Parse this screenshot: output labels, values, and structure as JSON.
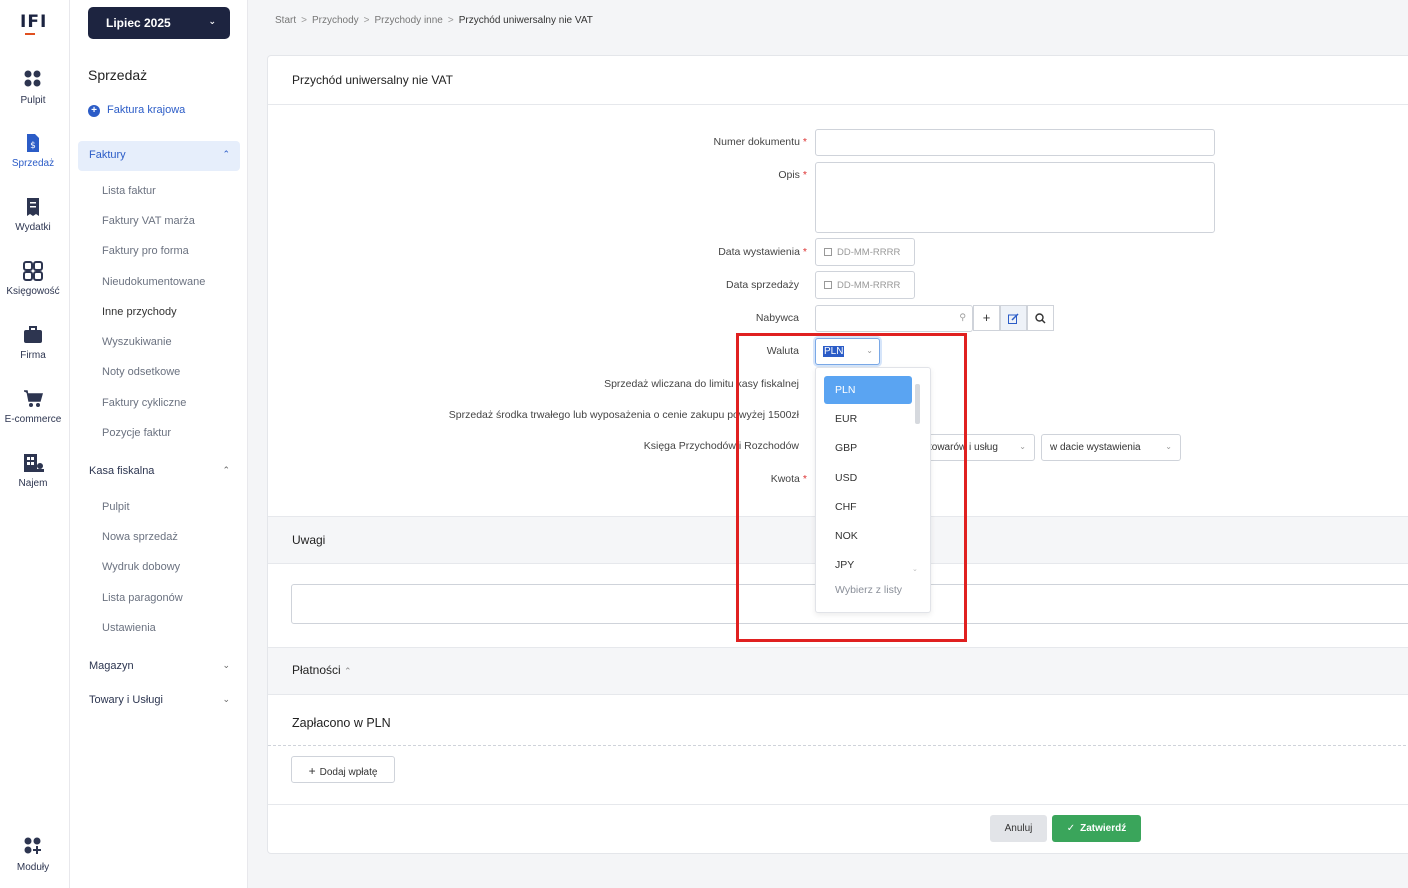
{
  "rail": {
    "logo": "IFI",
    "items": [
      {
        "label": "Pulpit",
        "icon": "dashboard-icon"
      },
      {
        "label": "Sprzedaż",
        "icon": "invoice-dollar-icon"
      },
      {
        "label": "Wydatki",
        "icon": "receipt-icon"
      },
      {
        "label": "Księgowość",
        "icon": "grid-icon"
      },
      {
        "label": "Firma",
        "icon": "briefcase-icon"
      },
      {
        "label": "E-commerce",
        "icon": "cart-icon"
      },
      {
        "label": "Najem",
        "icon": "building-icon"
      }
    ],
    "modules": "Moduły"
  },
  "sidebar": {
    "month": "Lipiec 2025",
    "title": "Sprzedaż",
    "quick_action": "Faktura krajowa",
    "groups": {
      "faktury": "Faktury",
      "kasa": "Kasa fiskalna",
      "magazyn": "Magazyn",
      "towary": "Towary i Usługi"
    },
    "faktury_items": [
      "Lista faktur",
      "Faktury VAT marża",
      "Faktury pro forma",
      "Nieudokumentowane",
      "Inne przychody",
      "Wyszukiwanie",
      "Noty odsetkowe",
      "Faktury cykliczne",
      "Pozycje faktur"
    ],
    "kasa_items": [
      "Pulpit",
      "Nowa sprzedaż",
      "Wydruk dobowy",
      "Lista paragonów",
      "Ustawienia"
    ]
  },
  "breadcrumb": [
    "Start",
    "Przychody",
    "Przychody inne",
    "Przychód uniwersalny nie VAT"
  ],
  "form": {
    "title": "Przychód uniwersalny nie VAT",
    "numer_label": "Numer dokumentu",
    "opis_label": "Opis",
    "data_wyst_label": "Data wystawienia",
    "data_sprz_label": "Data sprzedaży",
    "date_placeholder": "DD-MM-RRRR",
    "nabywca_label": "Nabywca",
    "waluta_label": "Waluta",
    "waluta_value": "PLN",
    "limit_label": "Sprzedaż wliczana do limitu kasy fiskalnej",
    "srodek_label": "Sprzedaż środka trwałego lub wyposażenia o cenie zakupu powyżej 1500zł",
    "ksiega_label": "Księga Przychodów i Rozchodów",
    "ksiega_select": "towarów i usług",
    "date_mode_select": "w dacie wystawienia",
    "kwota_label": "Kwota",
    "required_mark": "*"
  },
  "currency_dropdown": {
    "options": [
      "PLN",
      "EUR",
      "GBP",
      "USD",
      "CHF",
      "NOK",
      "JPY"
    ],
    "selected": "PLN",
    "footer": "Wybierz z listy"
  },
  "uwagi": {
    "title": "Uwagi"
  },
  "platnosci": {
    "title": "Płatności",
    "paid_title": "Zapłacono w PLN",
    "add_payment": "Dodaj wpłatę"
  },
  "actions": {
    "cancel": "Anuluj",
    "confirm": "Zatwierdź"
  },
  "colors": {
    "primary": "#1d2440",
    "accent": "#2b5cc7",
    "confirm": "#3aa55b",
    "highlight": "#e02020"
  }
}
